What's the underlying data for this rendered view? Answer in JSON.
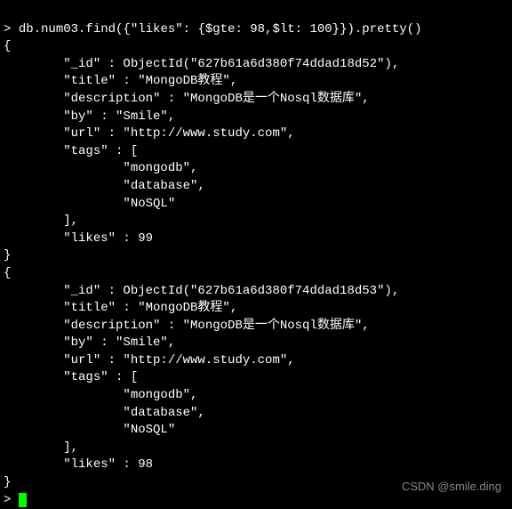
{
  "prompt_symbol": "> ",
  "command": "db.num03.find({\"likes\": {$gte: 98,$lt: 100}}).pretty()",
  "docs": [
    {
      "_id": "ObjectId(\"627b61a6d380f74ddad18d52\")",
      "title": "MongoDB教程",
      "description": "MongoDB是一个Nosql数据库",
      "by": "Smile",
      "url": "http://www.study.com",
      "tags": [
        "mongodb",
        "database",
        "NoSQL"
      ],
      "likes": 99
    },
    {
      "_id": "ObjectId(\"627b61a6d380f74ddad18d53\")",
      "title": "MongoDB教程",
      "description": "MongoDB是一个Nosql数据库",
      "by": "Smile",
      "url": "http://www.study.com",
      "tags": [
        "mongodb",
        "database",
        "NoSQL"
      ],
      "likes": 98
    }
  ],
  "watermark": "CSDN @smile.ding",
  "indent1": "        ",
  "indent2": "                "
}
